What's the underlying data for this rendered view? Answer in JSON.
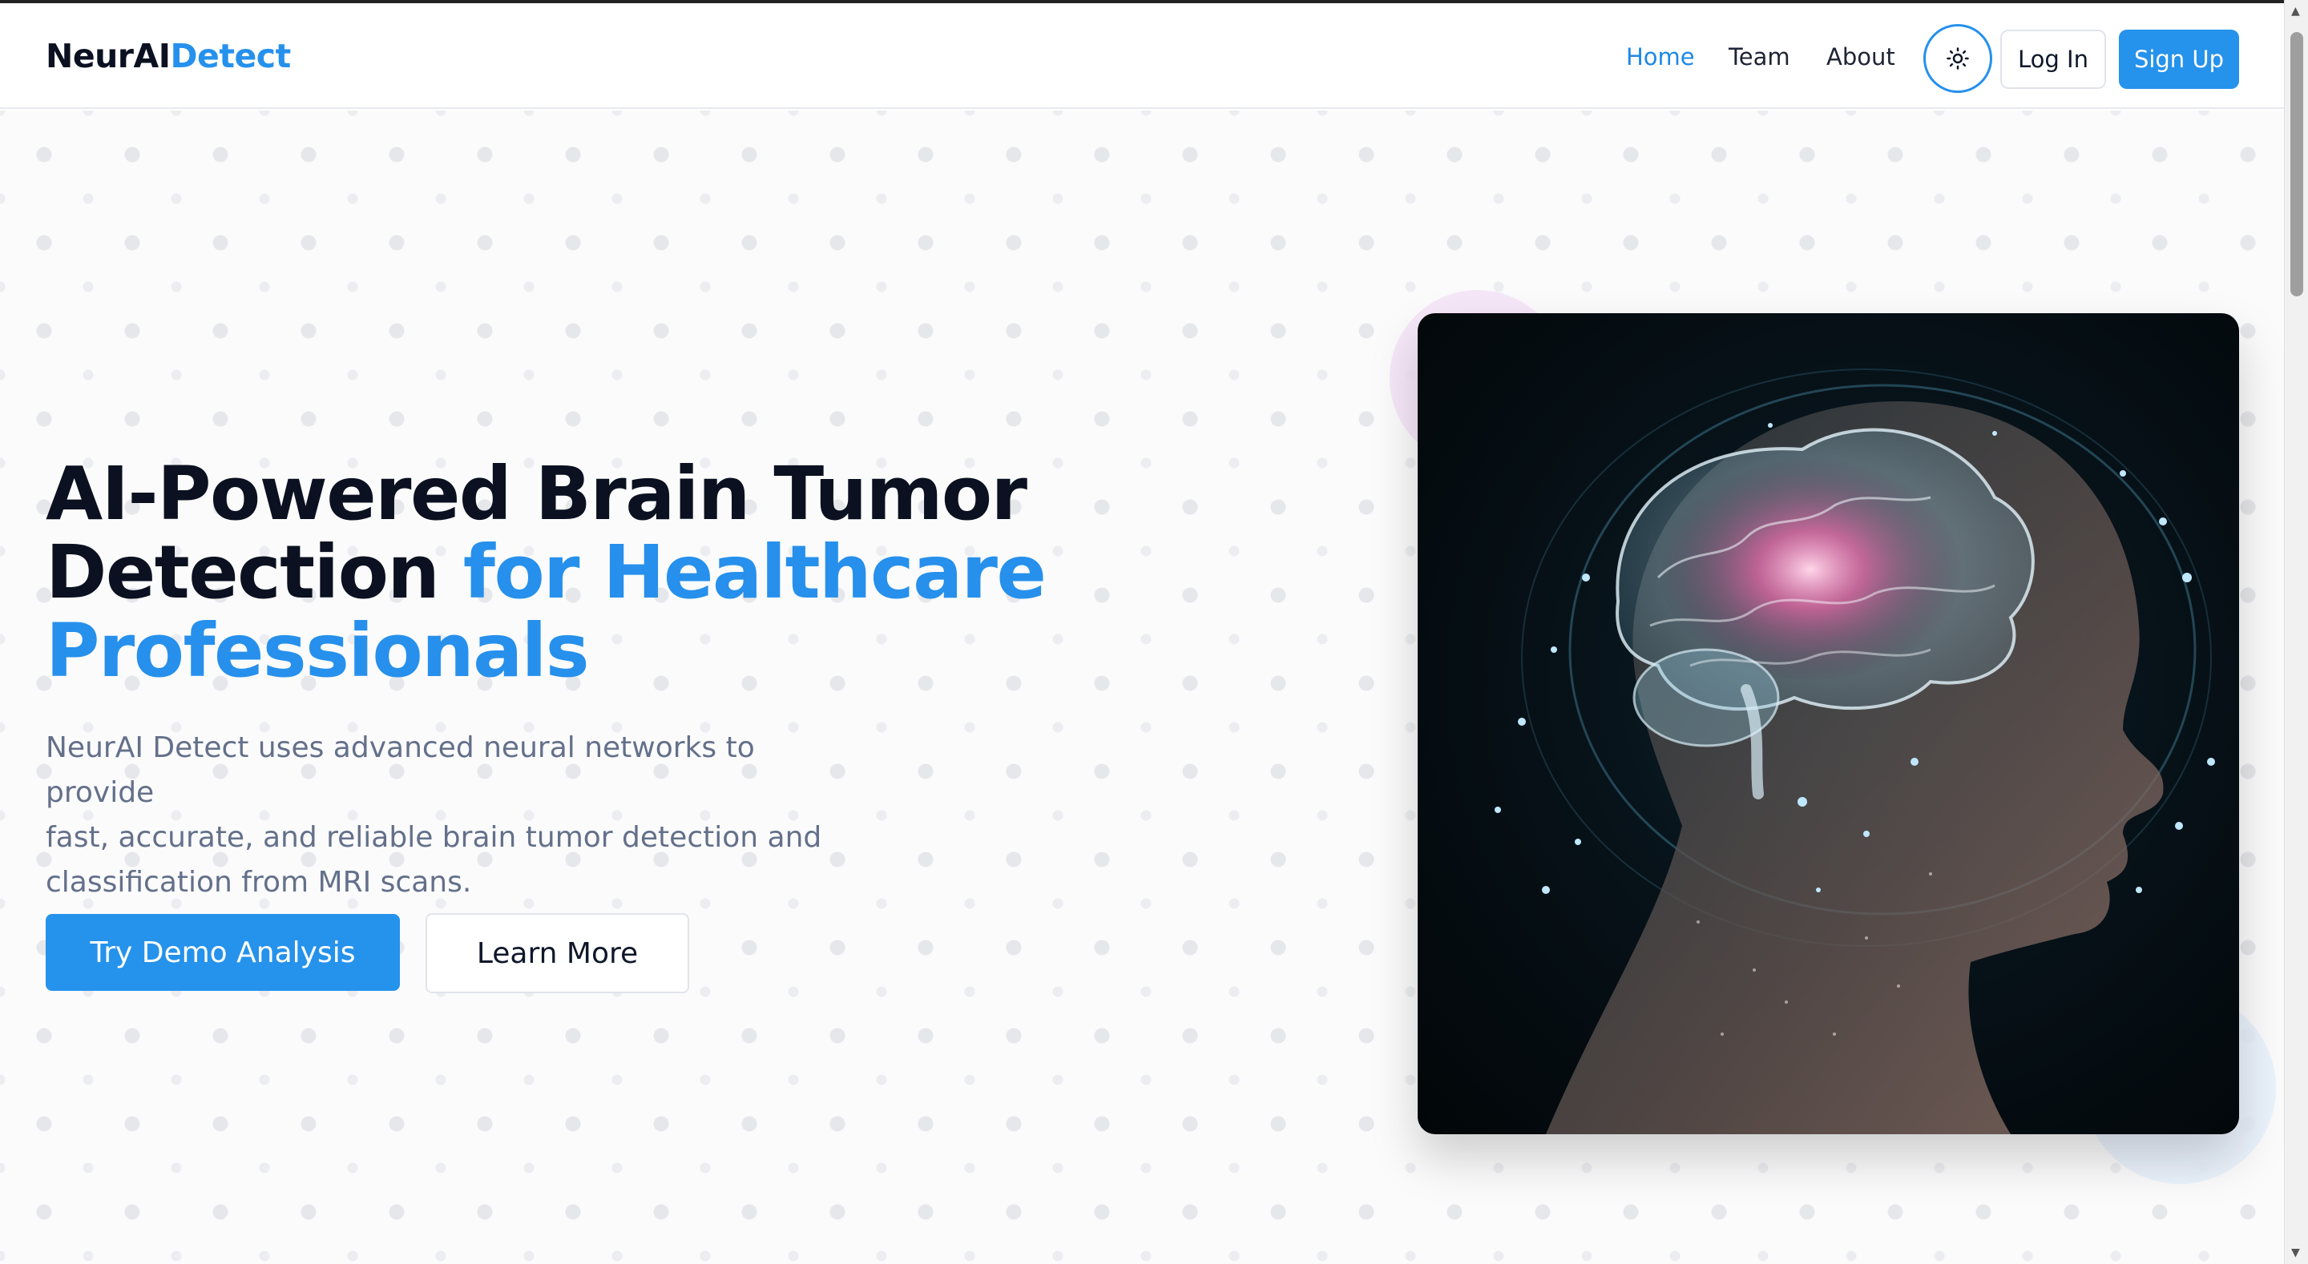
{
  "header": {
    "logo_main": "NeurAI",
    "logo_accent": "Detect",
    "nav": [
      {
        "label": "Home",
        "active": true
      },
      {
        "label": "Team",
        "active": false
      },
      {
        "label": "About",
        "active": false
      }
    ],
    "theme_toggle_icon": "sun-icon",
    "login_label": "Log In",
    "signup_label": "Sign Up"
  },
  "hero": {
    "headline_line1": "AI-Powered Brain Tumor",
    "headline_line2_dark": "Detection ",
    "headline_line2_blue": "for Healthcare",
    "headline_line3_blue": "Professionals",
    "subtext_lines": [
      "NeurAI Detect uses advanced neural networks to provide",
      "fast, accurate, and reliable brain tumor detection and",
      "classification from MRI scans."
    ],
    "primary_button": "Try Demo Analysis",
    "secondary_button": "Learn More",
    "image_subject": "glowing-brain-head-illustration"
  },
  "colors": {
    "accent": "#2592ec",
    "text_dark": "#0b1120",
    "text_muted": "#64708a"
  }
}
